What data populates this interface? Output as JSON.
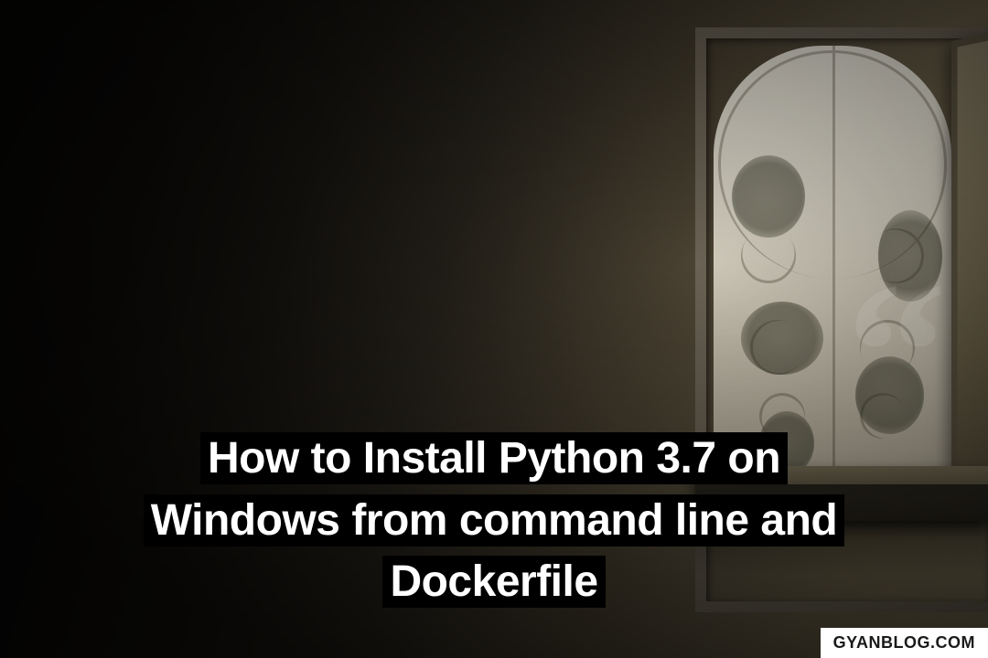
{
  "title": "How to Install Python 3.7 on Windows from command line and Dockerfile",
  "watermark": "GYANBLOG.COM",
  "quote_decoration": "“"
}
